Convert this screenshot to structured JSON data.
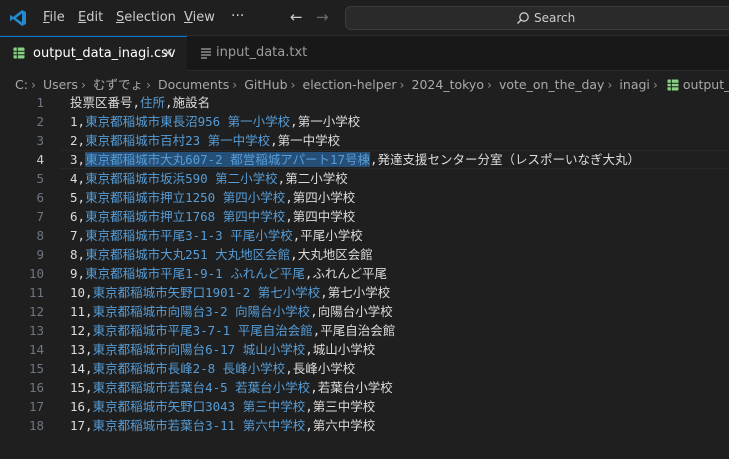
{
  "window": {
    "menus": [
      {
        "underline": "F",
        "rest": "ile"
      },
      {
        "underline": "E",
        "rest": "dit"
      },
      {
        "underline": "S",
        "rest": "election"
      },
      {
        "underline": "V",
        "rest": "iew"
      }
    ],
    "more": "···",
    "back_glyph": "←",
    "forward_glyph": "→",
    "search_label": "Search",
    "accent_color": "#0078d4"
  },
  "tabs": [
    {
      "label": "output_data_inagi.csv",
      "icon": "csv-file-icon",
      "close": "×"
    },
    {
      "label": "input_data.txt",
      "icon": "text-file-icon"
    }
  ],
  "breadcrumb": {
    "items": [
      "C:",
      "Users",
      "むずでょ",
      "Documents",
      "GitHub",
      "election-helper",
      "2024_tokyo",
      "vote_on_the_day",
      "inagi",
      "output_data_"
    ],
    "separator": "›"
  },
  "editor": {
    "line_numbers": [
      "1",
      "2",
      "3",
      "4",
      "5",
      "6",
      "7",
      "8",
      "9",
      "10",
      "11",
      "12",
      "13",
      "14",
      "15",
      "16",
      "17",
      "18"
    ],
    "lines": [
      {
        "pre": "",
        "addr": "",
        "post": "投票区番号,",
        "addr2": "住所",
        "post2": ",施設名"
      },
      {
        "pre": "1,",
        "addr": "東京都稲城市東長沼956 第一小学校",
        "post": ",第一小学校"
      },
      {
        "pre": "2,",
        "addr": "東京都稲城市百村23 第一中学校",
        "post": ",第一中学校"
      },
      {
        "pre": "3,",
        "addr": "東京都稲城市大丸607-2 都営稲城アパート17号棟",
        "post": ",発達支援センター分室（レスポーいなぎ大丸）"
      },
      {
        "pre": "4,",
        "addr": "東京都稲城市坂浜590 第二小学校",
        "post": ",第二小学校"
      },
      {
        "pre": "5,",
        "addr": "東京都稲城市押立1250 第四小学校",
        "post": ",第四小学校"
      },
      {
        "pre": "6,",
        "addr": "東京都稲城市押立1768 第四中学校",
        "post": ",第四中学校"
      },
      {
        "pre": "7,",
        "addr": "東京都稲城市平尾3-1-3 平尾小学校",
        "post": ",平尾小学校"
      },
      {
        "pre": "8,",
        "addr": "東京都稲城市大丸251 大丸地区会館",
        "post": ",大丸地区会館"
      },
      {
        "pre": "9,",
        "addr": "東京都稲城市平尾1-9-1 ふれんど平尾",
        "post": ",ふれんど平尾"
      },
      {
        "pre": "10,",
        "addr": "東京都稲城市矢野口1901-2 第七小学校",
        "post": ",第七小学校"
      },
      {
        "pre": "11,",
        "addr": "東京都稲城市向陽台3-2 向陽台小学校",
        "post": ",向陽台小学校"
      },
      {
        "pre": "12,",
        "addr": "東京都稲城市平尾3-7-1 平尾自治会館",
        "post": ",平尾自治会館"
      },
      {
        "pre": "13,",
        "addr": "東京都稲城市向陽台6-17 城山小学校",
        "post": ",城山小学校"
      },
      {
        "pre": "14,",
        "addr": "東京都稲城市長峰2-8 長峰小学校",
        "post": ",長峰小学校"
      },
      {
        "pre": "15,",
        "addr": "東京都稲城市若葉台4-5 若葉台小学校",
        "post": ",若葉台小学校"
      },
      {
        "pre": "16,",
        "addr": "東京都稲城市矢野口3043 第三中学校",
        "post": ",第三中学校"
      },
      {
        "pre": "17,",
        "addr": "東京都稲城市若葉台3-11 第六中学校",
        "post": ",第六中学校"
      },
      {
        "pre": "",
        "addr": "",
        "post": ""
      }
    ],
    "current_line": "4",
    "address_color": "#569cd6",
    "selection_color": "#264f78"
  }
}
